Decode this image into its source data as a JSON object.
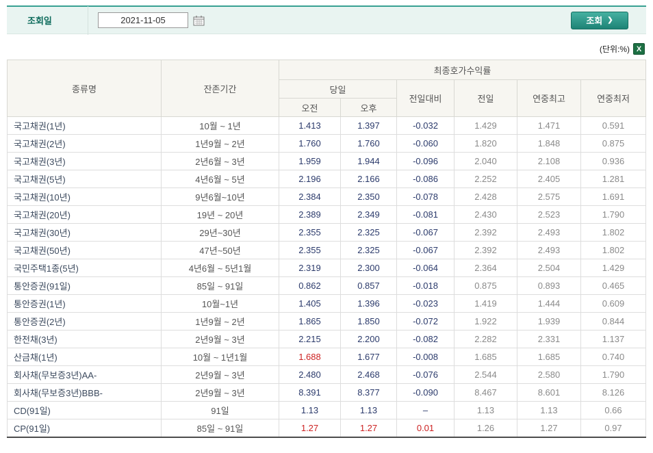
{
  "search_bar": {
    "label": "조회일",
    "date_value": "2021-11-05",
    "button_label": "조회",
    "button_arrow": "❯"
  },
  "unit_label": "(단위:%)",
  "icons": {
    "excel_letter": "X"
  },
  "colors": {
    "accent_teal": "#1e8376",
    "value_navy": "#2b3a6b",
    "value_red": "#cc2121",
    "value_gray": "#8a8a8a"
  },
  "table": {
    "headers": {
      "type": "종류명",
      "period": "잔존기간",
      "yield_group": "최종호가수익률",
      "today": "당일",
      "am": "오전",
      "pm": "오후",
      "change": "전일대비",
      "prev": "전일",
      "high": "연중최고",
      "low": "연중최저"
    },
    "rows": [
      {
        "name": "국고채권(1년)",
        "period": "10월 ~ 1년",
        "am": "1.413",
        "pm": "1.397",
        "chg": "-0.032",
        "prev": "1.429",
        "high": "1.471",
        "low": "0.591",
        "red": []
      },
      {
        "name": "국고채권(2년)",
        "period": "1년9월 ~ 2년",
        "am": "1.760",
        "pm": "1.760",
        "chg": "-0.060",
        "prev": "1.820",
        "high": "1.848",
        "low": "0.875",
        "red": []
      },
      {
        "name": "국고채권(3년)",
        "period": "2년6월 ~ 3년",
        "am": "1.959",
        "pm": "1.944",
        "chg": "-0.096",
        "prev": "2.040",
        "high": "2.108",
        "low": "0.936",
        "red": []
      },
      {
        "name": "국고채권(5년)",
        "period": "4년6월 ~ 5년",
        "am": "2.196",
        "pm": "2.166",
        "chg": "-0.086",
        "prev": "2.252",
        "high": "2.405",
        "low": "1.281",
        "red": []
      },
      {
        "name": "국고채권(10년)",
        "period": "9년6월~10년",
        "am": "2.384",
        "pm": "2.350",
        "chg": "-0.078",
        "prev": "2.428",
        "high": "2.575",
        "low": "1.691",
        "red": []
      },
      {
        "name": "국고채권(20년)",
        "period": "19년 ~ 20년",
        "am": "2.389",
        "pm": "2.349",
        "chg": "-0.081",
        "prev": "2.430",
        "high": "2.523",
        "low": "1.790",
        "red": []
      },
      {
        "name": "국고채권(30년)",
        "period": "29년~30년",
        "am": "2.355",
        "pm": "2.325",
        "chg": "-0.067",
        "prev": "2.392",
        "high": "2.493",
        "low": "1.802",
        "red": []
      },
      {
        "name": "국고채권(50년)",
        "period": "47년~50년",
        "am": "2.355",
        "pm": "2.325",
        "chg": "-0.067",
        "prev": "2.392",
        "high": "2.493",
        "low": "1.802",
        "red": []
      },
      {
        "name": "국민주택1종(5년)",
        "period": "4년6월 ~ 5년1월",
        "am": "2.319",
        "pm": "2.300",
        "chg": "-0.064",
        "prev": "2.364",
        "high": "2.504",
        "low": "1.429",
        "red": []
      },
      {
        "name": "통안증권(91일)",
        "period": "85일 ~ 91일",
        "am": "0.862",
        "pm": "0.857",
        "chg": "-0.018",
        "prev": "0.875",
        "high": "0.893",
        "low": "0.465",
        "red": []
      },
      {
        "name": "통안증권(1년)",
        "period": "10월~1년",
        "am": "1.405",
        "pm": "1.396",
        "chg": "-0.023",
        "prev": "1.419",
        "high": "1.444",
        "low": "0.609",
        "red": []
      },
      {
        "name": "통안증권(2년)",
        "period": "1년9월 ~ 2년",
        "am": "1.865",
        "pm": "1.850",
        "chg": "-0.072",
        "prev": "1.922",
        "high": "1.939",
        "low": "0.844",
        "red": []
      },
      {
        "name": "한전채(3년)",
        "period": "2년9월 ~ 3년",
        "am": "2.215",
        "pm": "2.200",
        "chg": "-0.082",
        "prev": "2.282",
        "high": "2.331",
        "low": "1.137",
        "red": []
      },
      {
        "name": "산금채(1년)",
        "period": "10월 ~ 1년1월",
        "am": "1.688",
        "pm": "1.677",
        "chg": "-0.008",
        "prev": "1.685",
        "high": "1.685",
        "low": "0.740",
        "red": [
          "am"
        ]
      },
      {
        "name": "회사채(무보증3년)AA-",
        "period": "2년9월 ~ 3년",
        "am": "2.480",
        "pm": "2.468",
        "chg": "-0.076",
        "prev": "2.544",
        "high": "2.580",
        "low": "1.790",
        "red": []
      },
      {
        "name": "회사채(무보증3년)BBB-",
        "period": "2년9월 ~ 3년",
        "am": "8.391",
        "pm": "8.377",
        "chg": "-0.090",
        "prev": "8.467",
        "high": "8.601",
        "low": "8.126",
        "red": []
      },
      {
        "name": "CD(91일)",
        "period": "91일",
        "am": "1.13",
        "pm": "1.13",
        "chg": "–",
        "prev": "1.13",
        "high": "1.13",
        "low": "0.66",
        "red": []
      },
      {
        "name": "CP(91일)",
        "period": "85일 ~ 91일",
        "am": "1.27",
        "pm": "1.27",
        "chg": "0.01",
        "prev": "1.26",
        "high": "1.27",
        "low": "0.97",
        "red": [
          "am",
          "pm",
          "chg"
        ]
      }
    ]
  }
}
